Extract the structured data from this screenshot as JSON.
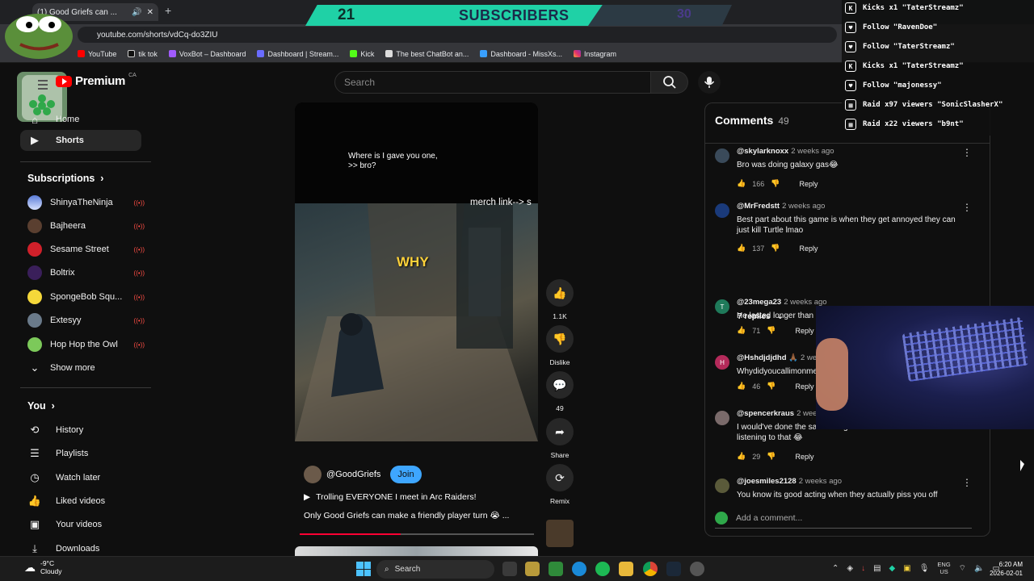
{
  "browser": {
    "tab_title": "(1) Good Griefs can ...",
    "url": "youtube.com/shorts/vdCq-do3ZIU",
    "bookmarks": [
      "YouTube",
      "tik tok",
      "VoxBot – Dashboard",
      "Dashboard | Stream...",
      "Kick",
      "The best ChatBot an...",
      "Dashboard - MissXs...",
      "Instagram"
    ]
  },
  "overlay": {
    "subscriber_count": "21",
    "subscriber_label": "SUBSCRIBERS",
    "subscriber_goal": "30",
    "events": [
      "Kicks x1 \"TaterStreamz\"",
      "Follow \"RavenDoe\"",
      "Follow \"TaterStreamz\"",
      "Kicks x1 \"TaterStreamz\"",
      "Follow \"majonessy\"",
      "Raid x97 viewers \"SonicSlasherX\"",
      "Raid x22 viewers \"b9nt\""
    ]
  },
  "youtube": {
    "logo_text": "Premium",
    "country": "CA",
    "search_placeholder": "Search",
    "nav": {
      "home": "Home",
      "shorts": "Shorts"
    },
    "subscriptions_title": "Subscriptions",
    "subscriptions": [
      "ShinyaTheNinja",
      "Bajheera",
      "Sesame Street",
      "Boltrix",
      "SpongeBob Squ...",
      "Extesyy",
      "Hop Hop the Owl"
    ],
    "show_more": "Show more",
    "you_title": "You",
    "you_items": [
      "History",
      "Playlists",
      "Watch later",
      "Liked videos",
      "Your videos",
      "Downloads"
    ]
  },
  "video": {
    "caption": "Where is I gave you one,\n>> bro?",
    "overlay_text": "merch link--> s",
    "why_text": "WHY",
    "channel": "@GoodGriefs",
    "join_label": "Join",
    "title": "Trolling EVERYONE I meet in Arc Raiders!",
    "description": "Only Good Griefs can make a friendly player turn 😭 ...",
    "progress": 0.43,
    "actions": {
      "likes": "1.1K",
      "dislike": "Dislike",
      "comments": "49",
      "share": "Share",
      "remix": "Remix"
    }
  },
  "comments": {
    "title": "Comments",
    "count": "49",
    "replies_label": "7 replies",
    "add_placeholder": "Add a comment...",
    "items": [
      {
        "user": "@skylarknoxx",
        "time": "2 weeks ago",
        "text": "Bro was doing galaxy gas😂",
        "likes": "166",
        "reply": "Reply"
      },
      {
        "user": "@MrFredstt",
        "time": "2 weeks ago",
        "text": "Best part about this game is when they get annoyed they can just kill Turtle lmao",
        "likes": "137",
        "reply": "Reply"
      },
      {
        "user": "@23mega23",
        "time": "2 weeks ago",
        "text": "He lasted longer than",
        "likes": "71",
        "reply": "Reply",
        "avatar_letter": "T"
      },
      {
        "user": "@Hshdjdjdhd 🙏🏾",
        "time": "2 wee",
        "text": "Whydidyoucallimonmeeeeeeee",
        "likes": "46",
        "reply": "Reply",
        "avatar_letter": "H"
      },
      {
        "user": "@spencerkraus",
        "time": "2 weeks ago",
        "text": "I would've done the same thing after about 10 seconds of listening to that 😂",
        "likes": "29",
        "reply": "Reply"
      },
      {
        "user": "@joesmiles2128",
        "time": "2 weeks ago",
        "text": "You know its good acting when they actually piss you off",
        "likes": "",
        "reply": ""
      }
    ]
  },
  "taskbar": {
    "temp": "-9°C",
    "condition": "Cloudy",
    "search": "Search",
    "lang1": "ENG",
    "lang2": "US",
    "time": "6:20 AM",
    "date": "2026-02-01"
  },
  "colors": {
    "accent_red": "#ff0000",
    "join_blue": "#3ea6ff",
    "subscriber_green": "#1fd1a6"
  }
}
